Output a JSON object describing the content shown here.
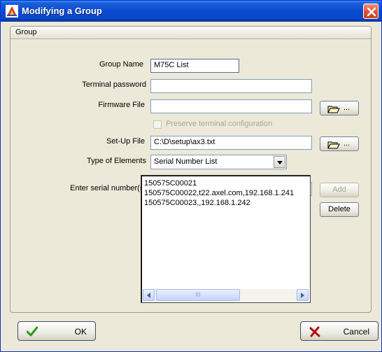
{
  "window": {
    "title": "Modifying a Group"
  },
  "group": {
    "header": "Group"
  },
  "form": {
    "group_name_label": "Group Name",
    "group_name_value": "M75C List",
    "terminal_password_label": "Terminal password",
    "terminal_password_value": "",
    "firmware_file_label": "Firmware File",
    "firmware_file_value": "",
    "firmware_browse_label": "...",
    "preserve_config_label": "Preserve terminal configuration",
    "setup_file_label": "Set-Up File",
    "setup_file_value": "C:\\D\\setup\\ax3.txt",
    "setup_browse_label": "...",
    "type_of_elements_label": "Type of Elements",
    "type_of_elements_value": "Serial Number List",
    "serial_input_label": "Enter serial number(s)",
    "serial_input_value": "",
    "add_button": "Add",
    "delete_button": "Delete",
    "scroll_thumb_grip": "III"
  },
  "serial_list": [
    "150575C00021",
    "150575C00022,t22.axel.com,192.168.1.241",
    "150575C00023,,192.168.1.242"
  ],
  "footer": {
    "ok_label": "OK",
    "cancel_label": "Cancel"
  },
  "icons": {
    "app": "app-icon",
    "close": "close-icon",
    "folder": "folder-open-icon",
    "ok": "checkmark-icon",
    "cancel": "cross-icon"
  },
  "colors": {
    "title_bar": "#0a4ad0",
    "window_bg": "#ece9d8",
    "ok_check": "#2a9a1a",
    "cancel_cross": "#b01010"
  }
}
